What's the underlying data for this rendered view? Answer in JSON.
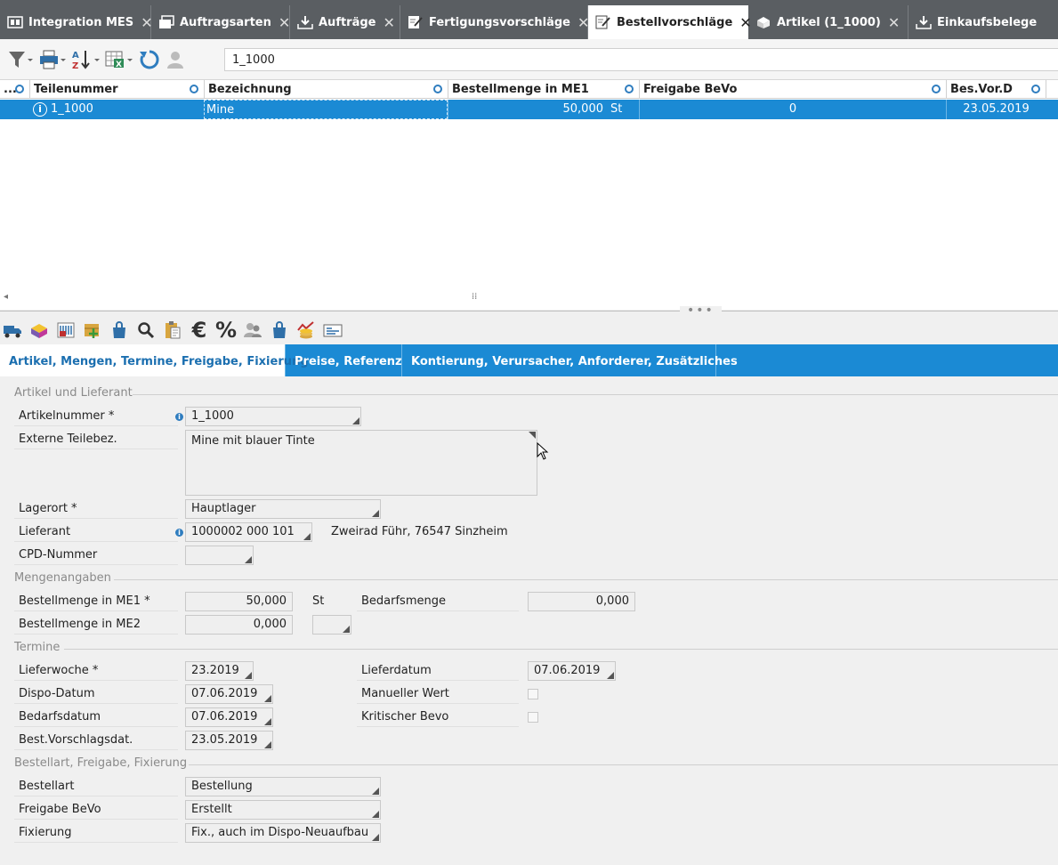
{
  "tabs": [
    {
      "label": "Integration MES",
      "icon": "mes-icon",
      "active": false
    },
    {
      "label": "Auftragsarten",
      "icon": "windows-icon",
      "active": false
    },
    {
      "label": "Aufträge",
      "icon": "download-icon",
      "active": false
    },
    {
      "label": "Fertigungsvorschläge",
      "icon": "edit-doc-icon",
      "active": false
    },
    {
      "label": "Bestellvorschläge",
      "icon": "edit-doc-icon",
      "active": true
    },
    {
      "label": "Artikel (1_1000)",
      "icon": "box-icon",
      "active": false
    },
    {
      "label": "Einkaufsbelege",
      "icon": "download-icon",
      "active": false
    }
  ],
  "toolbar": {
    "filter_value": "1_1000",
    "icons": [
      "filter-icon",
      "print-icon",
      "sort-icon",
      "excel-export-icon",
      "refresh-icon",
      "user-icon"
    ]
  },
  "grid": {
    "columns": [
      "...",
      "Teilenummer",
      "Bezeichnung",
      "Bestellmenge in ME1",
      "Freigabe BeVo",
      "Bes.Vor.D"
    ],
    "rows": [
      {
        "teilenummer": "1_1000",
        "bezeichnung": "Mine",
        "bestellmenge": "50,000",
        "einheit": "St",
        "freigabe": "0",
        "datum": "23.05.2019"
      }
    ],
    "scroll_left": "◂",
    "scroll_grip": "⁞⁞"
  },
  "splitter_dots": "•••",
  "function_icons": [
    "truck-icon",
    "package-icon",
    "barcode-list-icon",
    "box-add-icon",
    "bag-icon",
    "search-icon",
    "clipboard-icon",
    "euro-icon",
    "percent-icon",
    "users-icon",
    "bag-lock-icon",
    "chart-coins-icon",
    "card-icon"
  ],
  "function_glyphs": {
    "euro": "€",
    "percent": "%"
  },
  "detail_tabs": [
    {
      "label": "Artikel, Mengen, Termine, Freigabe, Fixierung",
      "active": true
    },
    {
      "label": "Preise, Referenz",
      "active": false
    },
    {
      "label": "Kontierung, Verursacher, Anforderer, Zusätzliches",
      "active": false
    }
  ],
  "sections": {
    "artikel": "Artikel und Lieferant",
    "mengen": "Mengenangaben",
    "termine": "Termine",
    "bestellart": "Bestellart, Freigabe, Fixierung"
  },
  "info_glyph": "i",
  "form": {
    "artikelnummer": {
      "label": "Artikelnummer *",
      "value": "1_1000"
    },
    "externe_teilebez": {
      "label": "Externe Teilebez.",
      "value": "Mine mit blauer Tinte"
    },
    "lagerort": {
      "label": "Lagerort *",
      "value": "Hauptlager"
    },
    "lieferant": {
      "label": "Lieferant",
      "value": "1000002 000 101",
      "name": "Zweirad Führ, 76547 Sinzheim"
    },
    "cpd_nummer": {
      "label": "CPD-Nummer",
      "value": ""
    },
    "bestellmenge_me1": {
      "label": "Bestellmenge in ME1 *",
      "value": "50,000",
      "unit": "St"
    },
    "bedarfsmenge": {
      "label": "Bedarfsmenge",
      "value": "0,000"
    },
    "bestellmenge_me2": {
      "label": "Bestellmenge in ME2",
      "value": "0,000",
      "unit": ""
    },
    "lieferwoche": {
      "label": "Lieferwoche *",
      "value": "23.2019"
    },
    "lieferdatum": {
      "label": "Lieferdatum",
      "value": "07.06.2019"
    },
    "dispo_datum": {
      "label": "Dispo-Datum",
      "value": "07.06.2019"
    },
    "manueller_wert": {
      "label": "Manueller Wert",
      "checked": false
    },
    "bedarfsdatum": {
      "label": "Bedarfsdatum",
      "value": "07.06.2019"
    },
    "kritischer_bevo": {
      "label": "Kritischer Bevo",
      "checked": false
    },
    "best_vorschlagsdat": {
      "label": "Best.Vorschlagsdat.",
      "value": "23.05.2019"
    },
    "bestellart": {
      "label": "Bestellart",
      "value": "Bestellung"
    },
    "freigabe_bevo": {
      "label": "Freigabe BeVo",
      "value": "Erstellt"
    },
    "fixierung": {
      "label": "Fixierung",
      "value": "Fix., auch im Dispo-Neuaufbau"
    }
  }
}
